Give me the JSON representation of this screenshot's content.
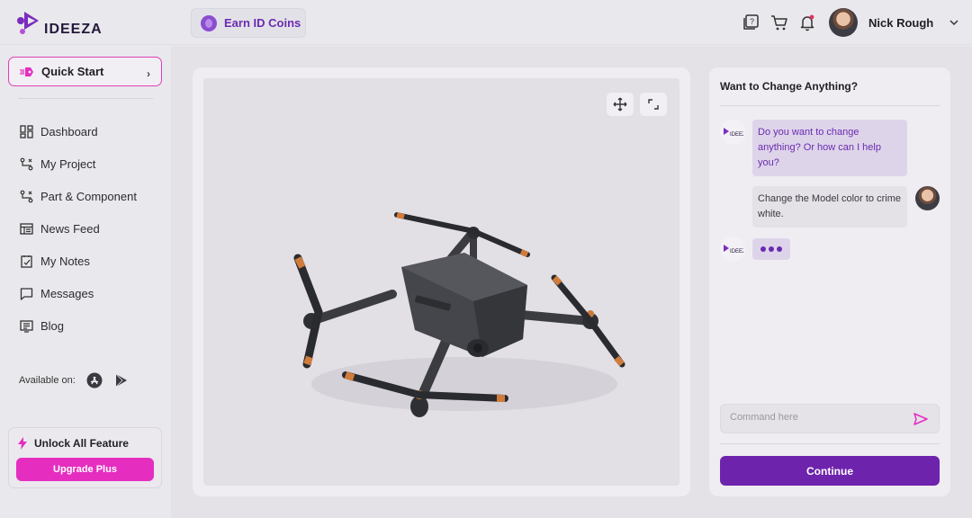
{
  "brand": {
    "name": "IDEEZA"
  },
  "header": {
    "earn_label": "Earn ID Coins",
    "user_name": "Nick Rough",
    "icons": [
      "help-box-icon",
      "cart-icon",
      "bell-icon",
      "chevron-down-icon"
    ]
  },
  "sidebar": {
    "quick_start": "Quick Start",
    "items": [
      {
        "label": "Dashboard",
        "icon": "dashboard-icon"
      },
      {
        "label": "My Project",
        "icon": "project-icon"
      },
      {
        "label": "Part & Component",
        "icon": "component-icon"
      },
      {
        "label": "News Feed",
        "icon": "news-icon"
      },
      {
        "label": "My Notes",
        "icon": "notes-icon"
      },
      {
        "label": "Messages",
        "icon": "messages-icon"
      },
      {
        "label": "Blog",
        "icon": "blog-icon"
      }
    ],
    "available_on": "Available on:",
    "unlock_title": "Unlock All Feature",
    "upgrade_label": "Upgrade Plus"
  },
  "chat": {
    "title": "Want to Change Anything?",
    "messages": [
      {
        "from": "bot",
        "text": "Do you want to change anything? Or how can I help you?"
      },
      {
        "from": "user",
        "text": "Change the Model color to crime white."
      }
    ],
    "input_placeholder": "Command here",
    "continue_label": "Continue"
  },
  "colors": {
    "accent_purple": "#6e23ad",
    "accent_pink": "#e52ec0",
    "bot_bubble": "#ded4ea"
  }
}
